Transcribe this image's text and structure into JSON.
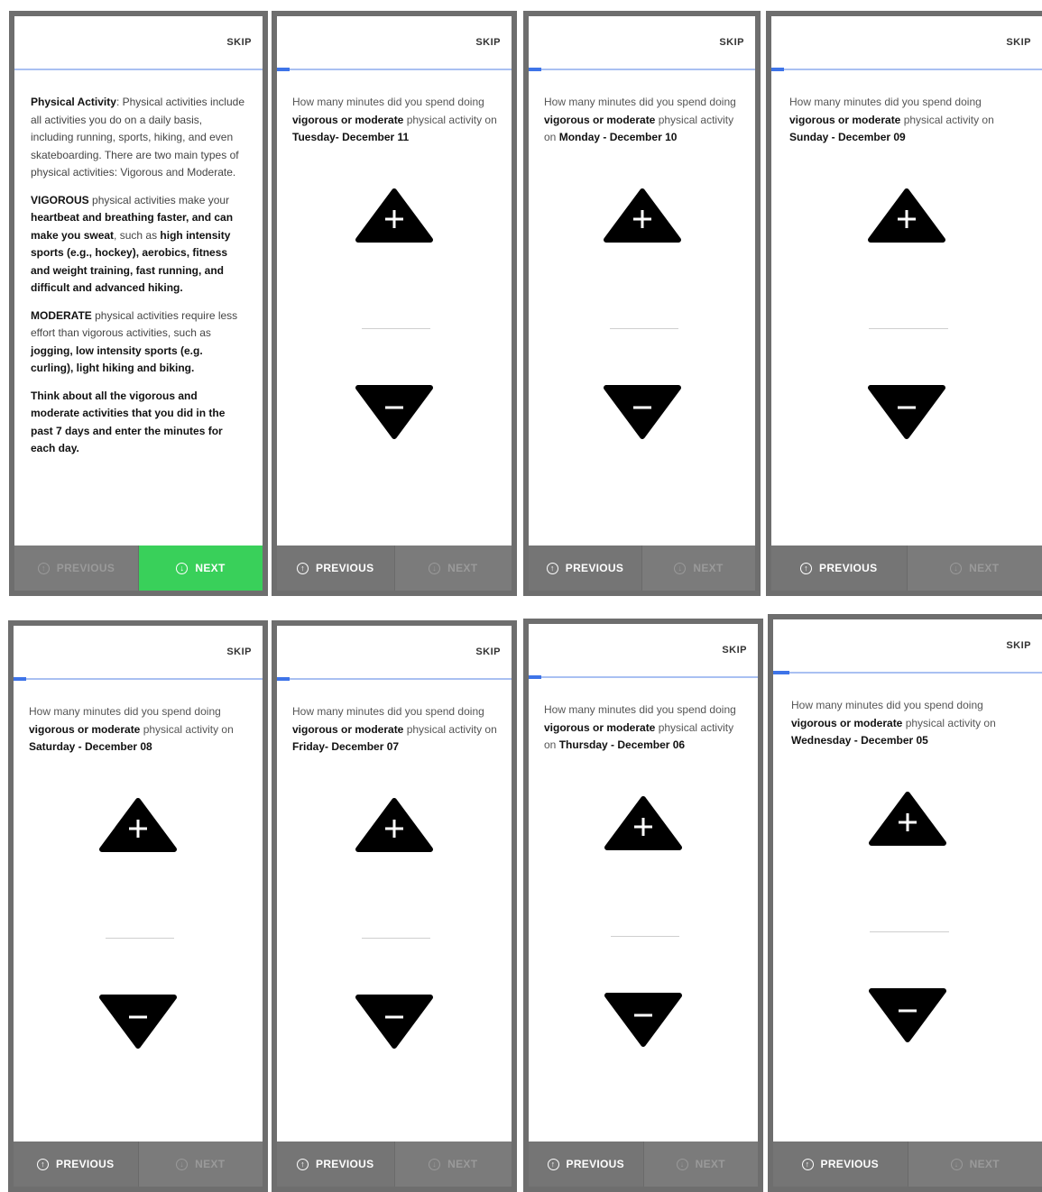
{
  "common": {
    "skip_label": "SKIP",
    "previous_label": "PREVIOUS",
    "next_label": "NEXT",
    "question_prefix": "How many minutes did you spend doing",
    "question_bold": "vigorous or moderate",
    "question_suffix": "physical activity on",
    "colors": {
      "frame": "#6e6e6e",
      "footer": "#757575",
      "next_active": "#39d05a",
      "progress": "#3e74e8"
    }
  },
  "intro": {
    "p1_bold": "Physical Activity",
    "p1_text": ": Physical activities include all activities you do on a daily basis, including running, sports, hiking, and even skateboarding. There are two main types of physical activities: Vigorous and Moderate.",
    "p2_bold1": "VIGOROUS",
    "p2_text1": " physical activities make your ",
    "p2_bold2": "heartbeat and breathing faster, and can make you sweat",
    "p2_text2": ", such as ",
    "p2_bold3": "high intensity sports (e.g., hockey), aerobics, fitness and weight training, fast running, and difficult and advanced hiking.",
    "p3_bold1": "MODERATE",
    "p3_text1": " physical activities require less effort than vigorous activities, such as ",
    "p3_bold2": "jogging, low intensity sports (e.g. curling), light hiking and biking.",
    "p4_bold": "Think about all the vigorous and moderate activities that you did in the past 7 days and enter the minutes for each day."
  },
  "screens": [
    {
      "day": "Tuesday- December 11",
      "minutes": ""
    },
    {
      "day": "Monday - December 10",
      "minutes": ""
    },
    {
      "day": "Sunday - December 09",
      "minutes": ""
    },
    {
      "day": "Saturday - December 08",
      "minutes": ""
    },
    {
      "day": "Friday- December 07",
      "minutes": ""
    },
    {
      "day": "Thursday - December 06",
      "minutes": ""
    },
    {
      "day": "Wednesday - December 05",
      "minutes": ""
    }
  ]
}
